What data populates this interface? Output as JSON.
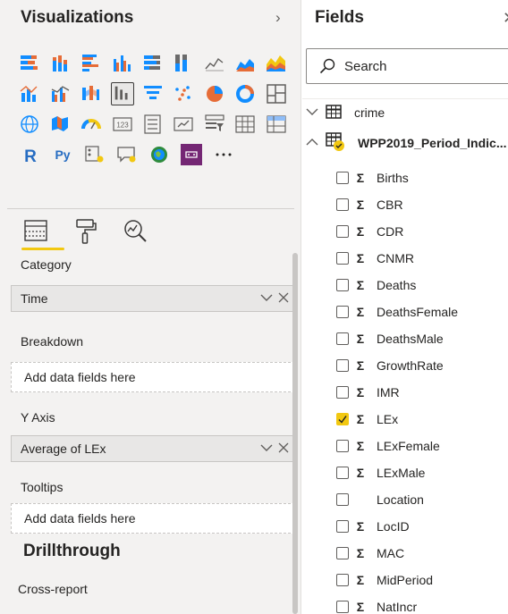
{
  "viz_panel": {
    "title": "Visualizations",
    "expand_icon": "chevron-right-icon"
  },
  "fields_panel": {
    "title": "Fields",
    "search_placeholder": "Search",
    "close_icon": "close-icon"
  },
  "visual_types": [
    [
      "stacked-bar-chart-icon",
      "stacked-column-chart-icon",
      "clustered-bar-chart-icon",
      "clustered-column-chart-icon",
      "100-stacked-bar-chart-icon",
      "100-stacked-column-chart-icon",
      "line-chart-icon",
      "area-chart-icon",
      "stacked-area-chart-icon"
    ],
    [
      "line-stacked-column-icon",
      "line-clustered-column-icon",
      "ribbon-chart-icon",
      "waterfall-chart-icon",
      "funnel-chart-icon",
      "scatter-chart-icon",
      "pie-chart-icon",
      "donut-chart-icon",
      "treemap-icon"
    ],
    [
      "map-icon",
      "filled-map-icon",
      "gauge-icon",
      "card-icon",
      "multi-row-card-icon",
      "kpi-icon",
      "slicer-icon",
      "table-icon",
      "matrix-icon"
    ],
    [
      "r-script-visual-icon",
      "python-visual-icon",
      "key-influencers-icon",
      "qa-visual-icon",
      "arcgis-map-icon",
      "power-apps-icon",
      "more-visuals-icon"
    ]
  ],
  "selected_visual": "waterfall-chart-icon",
  "format_tabs": [
    {
      "name": "fields-tab-icon",
      "active": true
    },
    {
      "name": "format-paint-roller-icon",
      "active": false
    },
    {
      "name": "analytics-magnifier-icon",
      "active": false
    }
  ],
  "wells": {
    "category": {
      "label": "Category",
      "field": "Time"
    },
    "breakdown": {
      "label": "Breakdown",
      "placeholder": "Add data fields here"
    },
    "y_axis": {
      "label": "Y Axis",
      "field": "Average of LEx"
    },
    "tooltips": {
      "label": "Tooltips",
      "placeholder": "Add data fields here"
    }
  },
  "drillthrough": {
    "title": "Drillthrough",
    "cross_report": "Cross-report"
  },
  "tables": [
    {
      "name": "crime",
      "expanded": false,
      "arrow": "chevron-down-icon"
    },
    {
      "name": "WPP2019_Period_Indic...",
      "expanded": true,
      "arrow": "chevron-up-icon"
    }
  ],
  "field_items": [
    {
      "name": "Births",
      "checked": false,
      "sigma": true
    },
    {
      "name": "CBR",
      "checked": false,
      "sigma": true
    },
    {
      "name": "CDR",
      "checked": false,
      "sigma": true
    },
    {
      "name": "CNMR",
      "checked": false,
      "sigma": true
    },
    {
      "name": "Deaths",
      "checked": false,
      "sigma": true
    },
    {
      "name": "DeathsFemale",
      "checked": false,
      "sigma": true
    },
    {
      "name": "DeathsMale",
      "checked": false,
      "sigma": true
    },
    {
      "name": "GrowthRate",
      "checked": false,
      "sigma": true
    },
    {
      "name": "IMR",
      "checked": false,
      "sigma": true
    },
    {
      "name": "LEx",
      "checked": true,
      "sigma": true
    },
    {
      "name": "LExFemale",
      "checked": false,
      "sigma": true
    },
    {
      "name": "LExMale",
      "checked": false,
      "sigma": true
    },
    {
      "name": "Location",
      "checked": false,
      "sigma": false
    },
    {
      "name": "LocID",
      "checked": false,
      "sigma": true
    },
    {
      "name": "MAC",
      "checked": false,
      "sigma": true
    },
    {
      "name": "MidPeriod",
      "checked": false,
      "sigma": true
    },
    {
      "name": "NatIncr",
      "checked": false,
      "sigma": true
    }
  ],
  "symbols": {
    "sigma": "Σ",
    "check": "✓",
    "chevron_right": "›",
    "close": "✕",
    "more": "···",
    "chevron_down": "⌵",
    "x": "✕",
    "tbl_down": "﹀",
    "tbl_up": "︿"
  },
  "colors": {
    "accent_yellow": "#f2c811",
    "chart_orange": "#e66c37",
    "chart_blue": "#118dff",
    "chart_purple": "#6b007b",
    "panel_bg": "#f3f2f1"
  }
}
